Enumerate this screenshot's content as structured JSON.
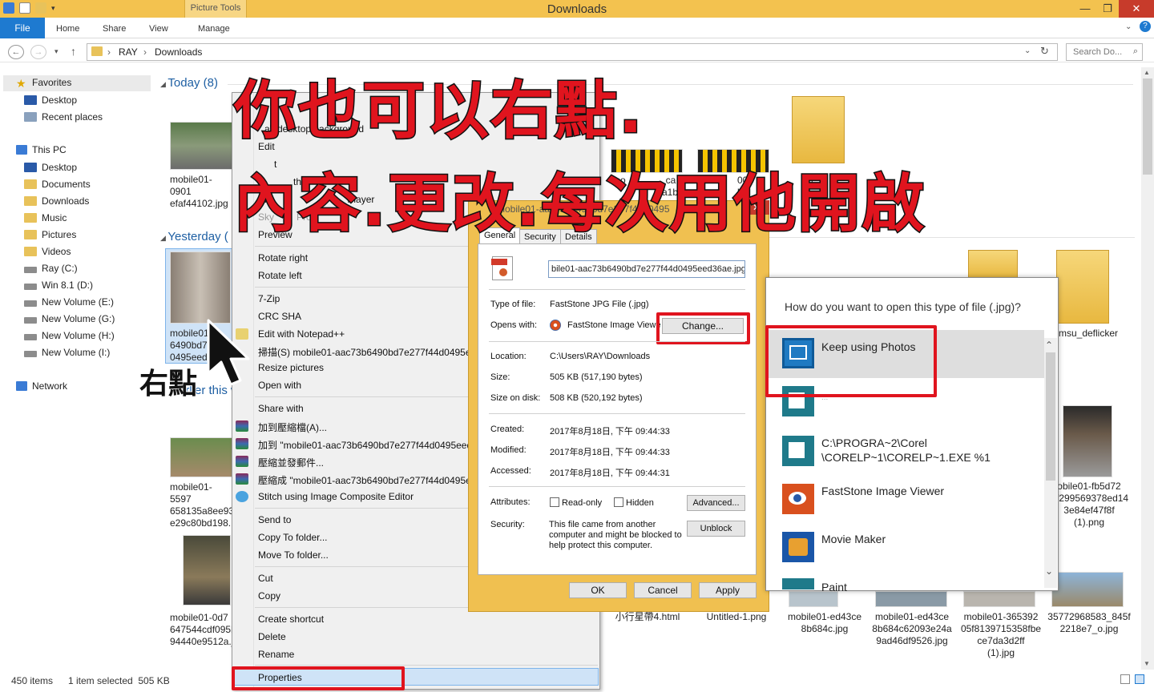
{
  "window": {
    "title": "Downloads",
    "context_tab": "Picture Tools"
  },
  "ribbon": {
    "file": "File",
    "tabs": [
      "Home",
      "Share",
      "View",
      "Manage"
    ]
  },
  "address": {
    "crumbs": [
      "RAY",
      "Downloads"
    ],
    "search_placeholder": "Search Do..."
  },
  "nav": {
    "favorites": "Favorites",
    "fav_items": [
      "Desktop",
      "Recent places"
    ],
    "thispc": "This PC",
    "pc_items": [
      "Desktop",
      "Documents",
      "Downloads",
      "Music",
      "Pictures",
      "Videos",
      "Ray (C:)",
      "Win 8.1 (D:)",
      "New Volume (E:)",
      "New Volume (G:)",
      "New Volume (H:)",
      "New Volume (I:)"
    ],
    "network": "Network"
  },
  "groups": {
    "today": "Today (8)",
    "yesterday": "Yesterday (",
    "earlier": "Earlier this w"
  },
  "files": {
    "f1": [
      "mobile01-0901",
      "efaf44102.jpg"
    ],
    "f2": [
      "mobile01-",
      "6490bd7e",
      "0495eed3"
    ],
    "f3": [
      "mobile01-5597",
      "658135a8ee93l",
      "e29c80bd198."
    ],
    "f4": [
      "mobile01-0d7",
      "647544cdf095b",
      "94440e9512a.j"
    ],
    "r1": [
      "mobile01-ed43ce",
      "8b684c.jpg"
    ],
    "r2": [
      "mobile01-ed43ce",
      "8b684c62093e24a",
      "9ad46df9526.jpg"
    ],
    "r3": [
      "mobile01-365392",
      "05f8139715358fbe",
      "ce7da3d2ff",
      "(1).jpg"
    ],
    "r4": [
      "35772968583_845f",
      "2218e7_o.jpg"
    ],
    "r5": [
      "小行星帶4.html"
    ],
    "r6": [
      "Untitled-1.png"
    ],
    "r7": [
      "obile01-fb5d72",
      "f299569378ed14",
      "3e84ef47f8f",
      "(1).png"
    ],
    "folder": "msu_deflicker",
    "partial1": [
      "mo",
      "ca",
      "a1b"
    ],
    "partial2": [
      "00",
      "b4"
    ],
    "partial3": "ri"
  },
  "context_menu": {
    "items_top": [
      "o",
      "as desktop background"
    ],
    "edit": "Edit",
    "frag_t": "t",
    "frag_th": "th",
    "play": "Pla",
    "player": "Player",
    "skype": "Sky",
    "pro": "Pro",
    "preview": "Preview",
    "rotate_right": "Rotate right",
    "rotate_left": "Rotate left",
    "zip": "7-Zip",
    "crc": "CRC SHA",
    "notepad": "Edit with Notepad++",
    "scan": "掃描(S) mobile01-aac73b6490bd7e277f44d0495ee",
    "resize": "Resize pictures",
    "openwith": "Open with",
    "sharewith": "Share with",
    "addarc": "加到壓縮檔(A)...",
    "addto": "加到 \"mobile01-aac73b6490bd7e277f44d0495eed",
    "compress_mail": "壓縮並發郵件...",
    "compress_to": "壓縮成 \"mobile01-aac73b6490bd7e277f44d0495e",
    "stitch": "Stitch using Image Composite Editor",
    "sendto": "Send to",
    "copyto": "Copy To folder...",
    "moveto": "Move To folder...",
    "cut": "Cut",
    "copy": "Copy",
    "shortcut": "Create shortcut",
    "delete": "Delete",
    "rename": "Rename",
    "properties": "Properties"
  },
  "dialog": {
    "title_frag": "mobile01-aac73b6490bd7e277f44d0495",
    "tabs": [
      "General",
      "Security",
      "Details"
    ],
    "filename": "bile01-aac73b6490bd7e277f44d0495eed36ae.jpg",
    "type_label": "Type of file:",
    "type_value": "FastStone JPG File (.jpg)",
    "opens_label": "Opens with:",
    "opens_value": "FastStone Image Viewe",
    "change": "Change...",
    "loc_label": "Location:",
    "loc_value": "C:\\Users\\RAY\\Downloads",
    "size_label": "Size:",
    "size_value": "505 KB (517,190 bytes)",
    "disk_label": "Size on disk:",
    "disk_value": "508 KB (520,192 bytes)",
    "created_label": "Created:",
    "created_value": "2017年8月18日, 下午 09:44:33",
    "modified_label": "Modified:",
    "modified_value": "2017年8月18日, 下午 09:44:33",
    "accessed_label": "Accessed:",
    "accessed_value": "2017年8月18日, 下午 09:44:31",
    "attr_label": "Attributes:",
    "readonly": "Read-only",
    "hidden": "Hidden",
    "advanced": "Advanced...",
    "sec_label": "Security:",
    "sec_text": [
      "This file came from another",
      "computer and might be blocked to",
      "help protect this computer."
    ],
    "unblock": "Unblock",
    "ok": "OK",
    "cancel": "Cancel",
    "apply": "Apply"
  },
  "openwith": {
    "question": "How do you want to open this type of file (.jpg)?",
    "keep": "Keep using Photos",
    "frag": "...",
    "corel": [
      "C:\\PROGRA~2\\Corel",
      "\\CORELP~1\\CORELP~1.EXE %1"
    ],
    "faststone": "FastStone Image Viewer",
    "moviemaker": "Movie Maker",
    "paint": "Paint"
  },
  "annotation": {
    "line1": "你也可以右點.",
    "line2": "內容.更改.每次用他開啟",
    "right_click": "右點"
  },
  "status": {
    "items": "450 items",
    "selected": "1 item selected  505 KB"
  }
}
